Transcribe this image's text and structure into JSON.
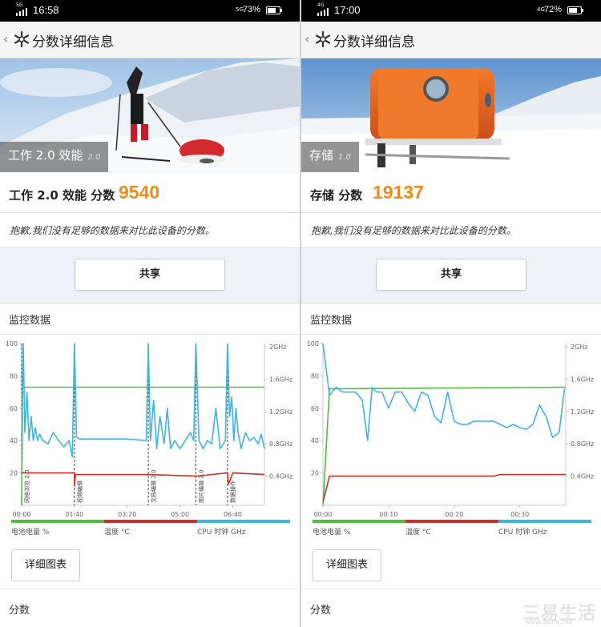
{
  "colors": {
    "accent": "#f08a1a",
    "battery": "#4fbe3d",
    "temperature": "#c9302c",
    "cpu": "#3fb4e0"
  },
  "icons": {
    "back": "chevron-left-icon",
    "logo": "snowflake-icon"
  },
  "left": {
    "status": {
      "network": "5G",
      "time": "16:58",
      "net2": "5G",
      "battery": "73%",
      "battery_level": 0.73
    },
    "title": "分数详细信息",
    "hero": {
      "name": "工作 2.0 效能",
      "version": "2.0"
    },
    "score": {
      "label": "工作 2.0 效能 分数",
      "value": "9540"
    },
    "message": "抱歉,我们没有足够的数据来对比此设备的分数。",
    "share": "共享",
    "monitor": {
      "title": "监控数据",
      "detail_button": "详细图表",
      "score_heading": "分数",
      "legend": [
        "电池电量 %",
        "温度 °C",
        "CPU 时钟 GHz"
      ]
    }
  },
  "right": {
    "status": {
      "network": "4G",
      "time": "17:00",
      "net2": "4G",
      "battery": "72%",
      "battery_level": 0.72
    },
    "title": "分数详细信息",
    "hero": {
      "name": "存储",
      "version": "1.0"
    },
    "score": {
      "label": "存储 分数",
      "value": "19137"
    },
    "message": "抱歉,我们没有足够的数据来对比此设备的分数。",
    "share": "共享",
    "monitor": {
      "title": "监控数据",
      "detail_button": "详细图表",
      "score_heading": "分数",
      "legend": [
        "电池电量 %",
        "温度 °C",
        "CPU 时钟 GHz"
      ]
    }
  },
  "watermark": {
    "main": "三易生活",
    "url": "www.3elife.net"
  },
  "chart_data": [
    {
      "type": "line",
      "title": "",
      "y_left_ticks": [
        20,
        40,
        60,
        80,
        100
      ],
      "y_right_ticks": [
        "0.4GHz",
        "0.8GHz",
        "1.2GHz",
        "1.6GHz",
        "2GHz"
      ],
      "x_ticks": [
        "00:00",
        "01:40",
        "03:20",
        "05:00",
        "06:40"
      ],
      "xlim": [
        0,
        460
      ],
      "ylim": [
        0,
        100
      ],
      "markers": [
        {
          "t": 0,
          "label": "网络浏览 2.0"
        },
        {
          "t": 100,
          "label": "视频编辑"
        },
        {
          "t": 240,
          "label": "文档编辑 2.0"
        },
        {
          "t": 330,
          "label": "图片编辑 2.0"
        },
        {
          "t": 390,
          "label": "数据操作"
        }
      ],
      "series": [
        {
          "name": "电池电量 %",
          "x": [
            0,
            2,
            460
          ],
          "y": [
            0,
            73,
            73
          ]
        },
        {
          "name": "温度 °C",
          "x": [
            0,
            100,
            100,
            102,
            240,
            330,
            390,
            392,
            400,
            460
          ],
          "y": [
            20,
            20,
            12,
            19,
            19,
            18,
            20,
            13,
            20,
            19
          ]
        },
        {
          "name": "CPU 时钟 GHz",
          "x": [
            0,
            3,
            6,
            10,
            14,
            18,
            22,
            26,
            30,
            34,
            40,
            50,
            60,
            70,
            80,
            90,
            96,
            100,
            104,
            110,
            130,
            160,
            200,
            236,
            240,
            244,
            250,
            256,
            262,
            270,
            276,
            282,
            290,
            300,
            310,
            320,
            326,
            330,
            336,
            344,
            352,
            360,
            368,
            376,
            386,
            390,
            394,
            398,
            402,
            406,
            410,
            416,
            424,
            432,
            440,
            448,
            454,
            460
          ],
          "y": [
            40,
            100,
            45,
            70,
            40,
            55,
            40,
            48,
            40,
            44,
            40,
            38,
            45,
            40,
            36,
            40,
            30,
            100,
            42,
            41,
            41,
            41,
            41,
            40,
            100,
            40,
            65,
            35,
            55,
            38,
            60,
            35,
            40,
            35,
            40,
            45,
            40,
            100,
            40,
            35,
            40,
            38,
            60,
            35,
            40,
            100,
            55,
            67,
            40,
            60,
            45,
            35,
            45,
            40,
            42,
            38,
            44,
            35
          ]
        }
      ]
    },
    {
      "type": "line",
      "title": "",
      "y_left_ticks": [
        20,
        40,
        60,
        80,
        100
      ],
      "y_right_ticks": [
        "0.4GHz",
        "0.8GHz",
        "1.2GHz",
        "1.6GHz",
        "2GHz"
      ],
      "x_ticks": [
        "00:00",
        "00:10",
        "00:20",
        "00:30"
      ],
      "xlim": [
        0,
        37
      ],
      "ylim": [
        0,
        100
      ],
      "markers": [],
      "series": [
        {
          "name": "电池电量 %",
          "x": [
            0,
            1,
            37
          ],
          "y": [
            0,
            72,
            73
          ]
        },
        {
          "name": "温度 °C",
          "x": [
            0,
            1,
            26,
            27,
            37
          ],
          "y": [
            2,
            18,
            18,
            19,
            19
          ]
        },
        {
          "name": "CPU 时钟 GHz",
          "x": [
            0,
            1,
            2,
            3,
            4,
            5,
            6,
            6.8,
            7.5,
            8.2,
            9,
            10,
            11,
            12,
            13,
            14,
            15,
            16,
            17,
            18,
            19,
            20,
            21,
            22,
            23,
            24,
            25,
            26,
            27,
            28,
            29,
            30,
            31,
            32,
            33,
            34,
            35,
            36,
            36.8
          ],
          "y": [
            100,
            68,
            73,
            70,
            70,
            70,
            65,
            40,
            73,
            70,
            70,
            60,
            70,
            70,
            63,
            58,
            70,
            68,
            55,
            51,
            70,
            52,
            50,
            50,
            52,
            52,
            52,
            52,
            50,
            48,
            50,
            48,
            47,
            50,
            62,
            55,
            42,
            45,
            72
          ]
        }
      ]
    }
  ]
}
